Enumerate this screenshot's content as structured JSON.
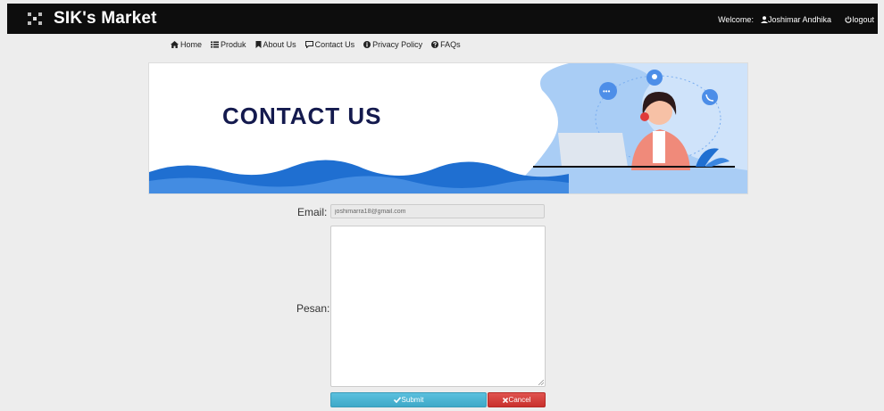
{
  "navbar": {
    "brand_name": "SIK's Market",
    "welcome_label": "Welcome:",
    "user_name": "Joshimar Andhika",
    "logout_label": "logout"
  },
  "menu": {
    "items": [
      {
        "label": "Home",
        "icon": "home-icon"
      },
      {
        "label": "Produk",
        "icon": "list-icon"
      },
      {
        "label": "About Us",
        "icon": "bookmark-icon"
      },
      {
        "label": "Contact Us",
        "icon": "chat-icon"
      },
      {
        "label": "Privacy Policy",
        "icon": "info-icon"
      },
      {
        "label": "FAQs",
        "icon": "question-icon"
      }
    ]
  },
  "banner": {
    "title": "CONTACT US"
  },
  "form": {
    "email_label": "Email:",
    "email_value": "joshimarra18@gmail.com",
    "message_label": "Pesan:",
    "message_value": "",
    "submit_label": "Submit",
    "cancel_label": "Cancel"
  },
  "colors": {
    "navbar_bg": "#0d0d0d",
    "banner_title": "#141a4e",
    "wave_blue": "#1f6fd1",
    "submit_bg": "#5bc0de",
    "cancel_bg": "#d9534f"
  }
}
